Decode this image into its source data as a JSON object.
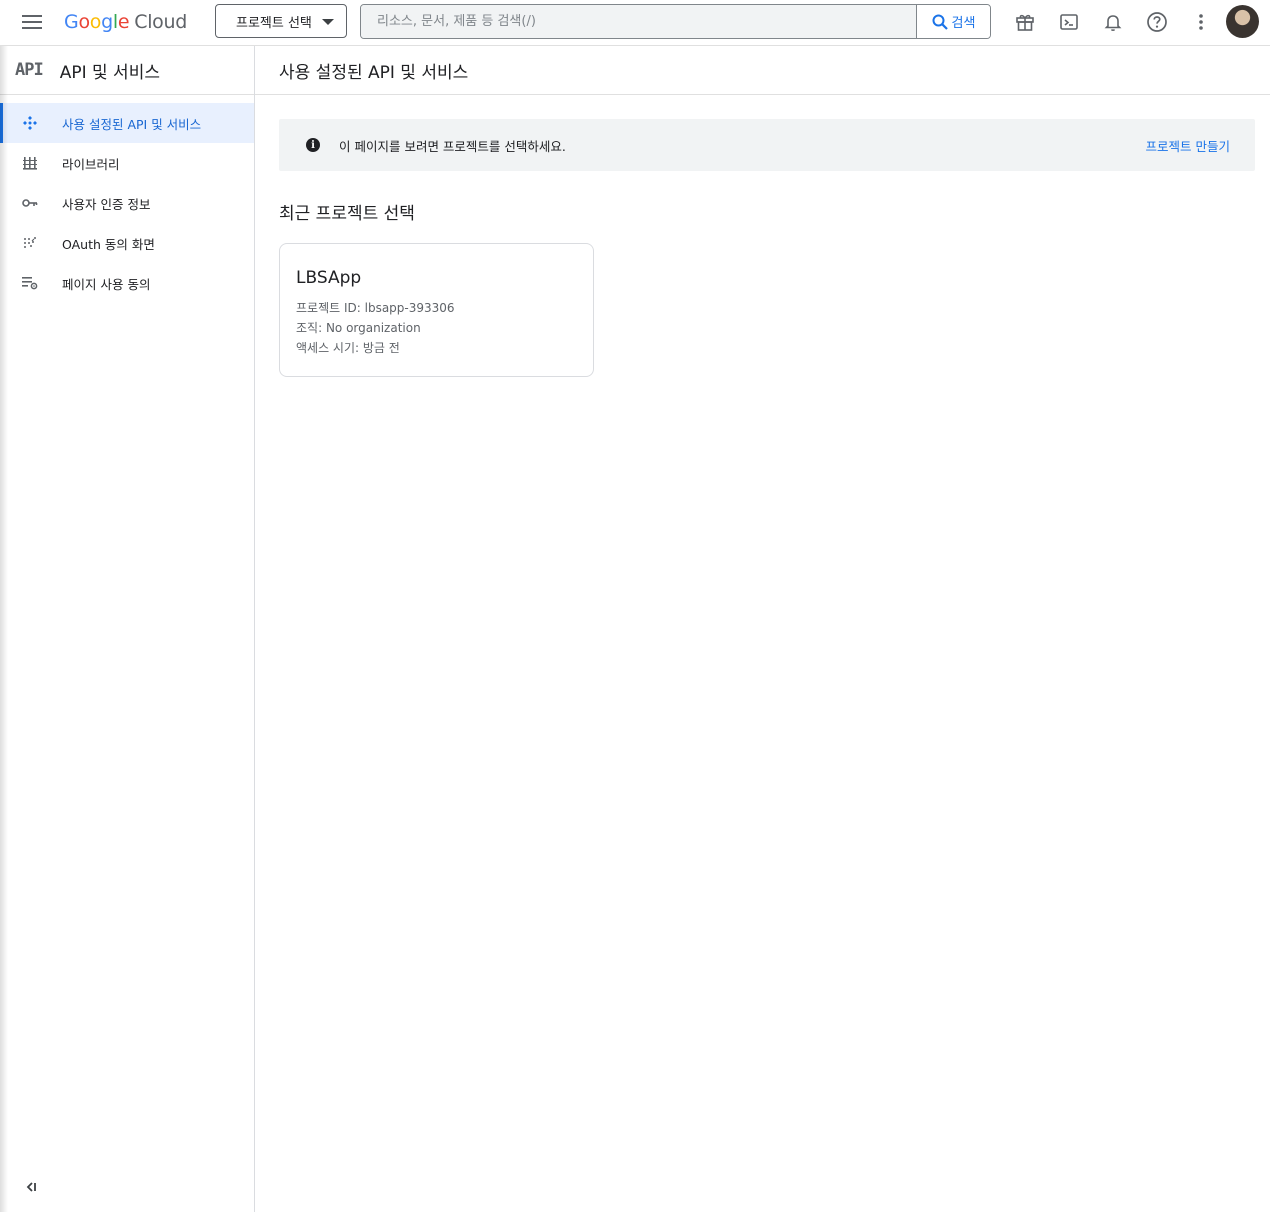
{
  "topbar": {
    "logo_text": [
      "G",
      "o",
      "o",
      "g",
      "l",
      "e"
    ],
    "logo_product": "Cloud",
    "project_picker_label": "프로젝트 선택",
    "search_placeholder": "리소스, 문서, 제품 등 검색(/)",
    "search_button_label": "검색",
    "icons": [
      "menu-icon",
      "gift-icon",
      "terminal-icon",
      "bell-icon",
      "help-icon",
      "more-vert-icon"
    ]
  },
  "sidebar": {
    "badge": "API",
    "title": "API 및 서비스",
    "items": [
      {
        "label": "사용 설정된 API 및 서비스",
        "icon": "apis-icon",
        "active": true
      },
      {
        "label": "라이브러리",
        "icon": "library-icon",
        "active": false
      },
      {
        "label": "사용자 인증 정보",
        "icon": "key-icon",
        "active": false
      },
      {
        "label": "OAuth 동의 화면",
        "icon": "oauth-icon",
        "active": false
      },
      {
        "label": "페이지 사용 동의",
        "icon": "settings-list-icon",
        "active": false
      }
    ]
  },
  "main": {
    "title": "사용 설정된 API 및 서비스",
    "banner": {
      "message": "이 페이지를 보려면 프로젝트를 선택하세요.",
      "action": "프로젝트 만들기"
    },
    "recent_title": "최근 프로젝트 선택",
    "project_card": {
      "name": "LBSApp",
      "id_line": "프로젝트 ID: lbsapp-393306",
      "org_line": "조직: No organization",
      "access_line": "액세스 시기: 방금 전"
    }
  },
  "colors": {
    "accent": "#1a73e8",
    "active_bg": "#e8f0fe",
    "banner_bg": "#f1f3f4"
  }
}
